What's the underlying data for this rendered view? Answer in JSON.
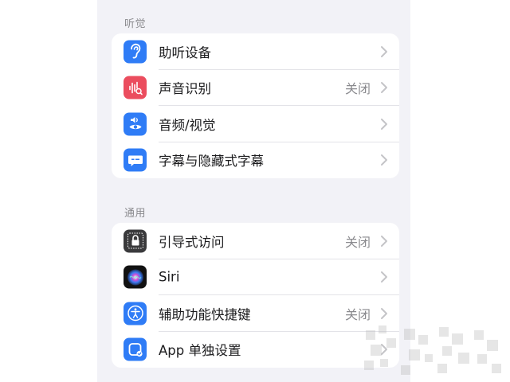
{
  "sections": [
    {
      "header": "听觉",
      "items": [
        {
          "label": "助听设备",
          "value": "",
          "icon": "ear-icon",
          "color": "#2f7cf6"
        },
        {
          "label": "声音识别",
          "value": "关闭",
          "icon": "sound-recognition-icon",
          "color": "#eb4d5e"
        },
        {
          "label": "音频/视觉",
          "value": "",
          "icon": "audio-visual-icon",
          "color": "#2f7cf6"
        },
        {
          "label": "字幕与隐藏式字幕",
          "value": "",
          "icon": "subtitles-icon",
          "color": "#2f7cf6"
        }
      ]
    },
    {
      "header": "通用",
      "items": [
        {
          "label": "引导式访问",
          "value": "关闭",
          "icon": "guided-access-lock-icon",
          "color": "#3a3a3c"
        },
        {
          "label": "Siri",
          "value": "",
          "icon": "siri-icon",
          "color": "#111111"
        },
        {
          "label": "辅助功能快捷键",
          "value": "关闭",
          "icon": "accessibility-icon",
          "color": "#2f7cf6"
        },
        {
          "label": "App 单独设置",
          "value": "",
          "icon": "per-app-settings-icon",
          "color": "#2f7cf6"
        }
      ]
    }
  ]
}
